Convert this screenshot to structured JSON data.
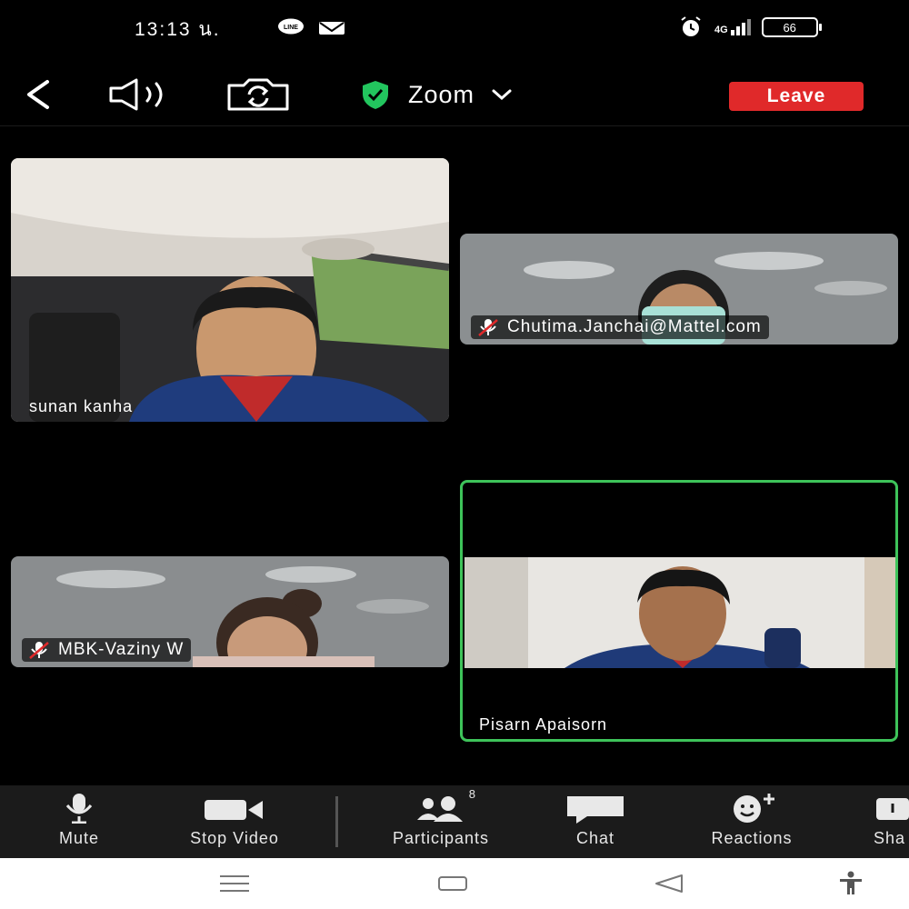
{
  "status": {
    "time": "13:13 น.",
    "network": "4G",
    "battery": "66"
  },
  "topbar": {
    "back_icon": "chevron-left-icon",
    "speaker_icon": "speaker-icon",
    "camera_flip_icon": "camera-switch-icon",
    "title": "Zoom",
    "leave_label": "Leave"
  },
  "participants_tiles": [
    {
      "name": "sunan kanha",
      "muted": false
    },
    {
      "name": "Chutima.Janchai@Mattel.com",
      "muted": true
    },
    {
      "name": "MBK-Vaziny W",
      "muted": true
    },
    {
      "name": "Pisarn Apaisorn",
      "muted": false,
      "active_speaker": true
    }
  ],
  "toolbar": {
    "mute_label": "Mute",
    "stop_video_label": "Stop Video",
    "participants_label": "Participants",
    "participants_count": "8",
    "chat_label": "Chat",
    "reactions_label": "Reactions",
    "share_label": "Sha"
  },
  "colors": {
    "accent_green": "#3ec35a",
    "leave_red": "#e0292a",
    "shield_green": "#22c55e"
  }
}
